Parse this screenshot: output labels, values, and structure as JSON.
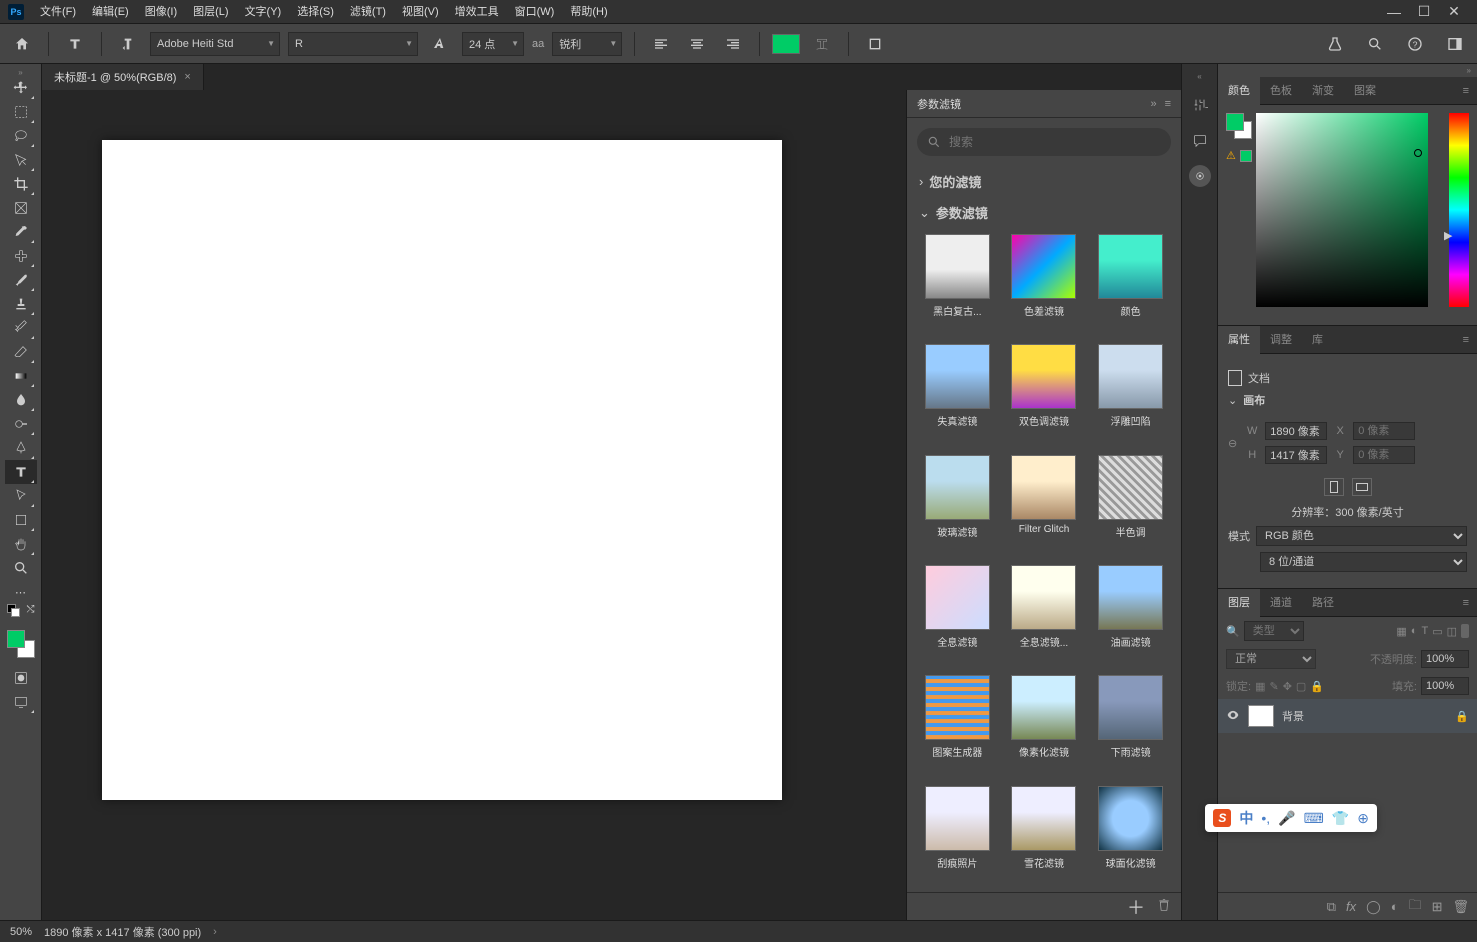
{
  "app_logo": "Ps",
  "menus": [
    "文件(F)",
    "编辑(E)",
    "图像(I)",
    "图层(L)",
    "文字(Y)",
    "选择(S)",
    "滤镜(T)",
    "视图(V)",
    "增效工具",
    "窗口(W)",
    "帮助(H)"
  ],
  "options": {
    "font_family": "Adobe Heiti Std",
    "font_style": "R",
    "font_size": "24 点",
    "aa_label": "aa",
    "aa_mode": "锐利",
    "fill_color": "#00cc66"
  },
  "document": {
    "tab_title": "未标题-1 @ 50%(RGB/8)"
  },
  "filters_panel": {
    "title": "参数滤镜",
    "search_placeholder": "搜索",
    "your_filters": "您的滤镜",
    "param_filters": "参数滤镜",
    "items": [
      "黑白复古...",
      "色差滤镜",
      "颜色",
      "失真滤镜",
      "双色调滤镜",
      "浮雕凹陷",
      "玻璃滤镜",
      "Filter Glitch",
      "半色调",
      "全息滤镜",
      "全息滤镜...",
      "油画滤镜",
      "图案生成器",
      "像素化滤镜",
      "下雨滤镜",
      "刮痕照片",
      "雪花滤镜",
      "球面化滤镜"
    ]
  },
  "color_tabs": [
    "颜色",
    "色板",
    "渐变",
    "图案"
  ],
  "props_tabs": [
    "属性",
    "调整",
    "库"
  ],
  "props": {
    "doc_label": "文档",
    "canvas_label": "画布",
    "w": "1890 像素",
    "h": "1417 像素",
    "x_placeholder": "0 像素",
    "y_placeholder": "0 像素",
    "resolution": "分辨率：300 像素/英寸",
    "mode_label": "模式",
    "mode": "RGB 颜色",
    "depth": "8 位/通道"
  },
  "layers_tabs": [
    "图层",
    "通道",
    "路径"
  ],
  "layers": {
    "type_placeholder": "类型",
    "blend": "正常",
    "opacity_label": "不透明度:",
    "opacity": "100%",
    "lock_label": "锁定:",
    "fill_label": "填充:",
    "fill": "100%",
    "bg_layer": "背景"
  },
  "status": {
    "zoom": "50%",
    "dims": "1890 像素 x 1417 像素 (300 ppi)"
  },
  "ime": {
    "zh": "中"
  },
  "colors": {
    "fg": "#00cc66"
  }
}
